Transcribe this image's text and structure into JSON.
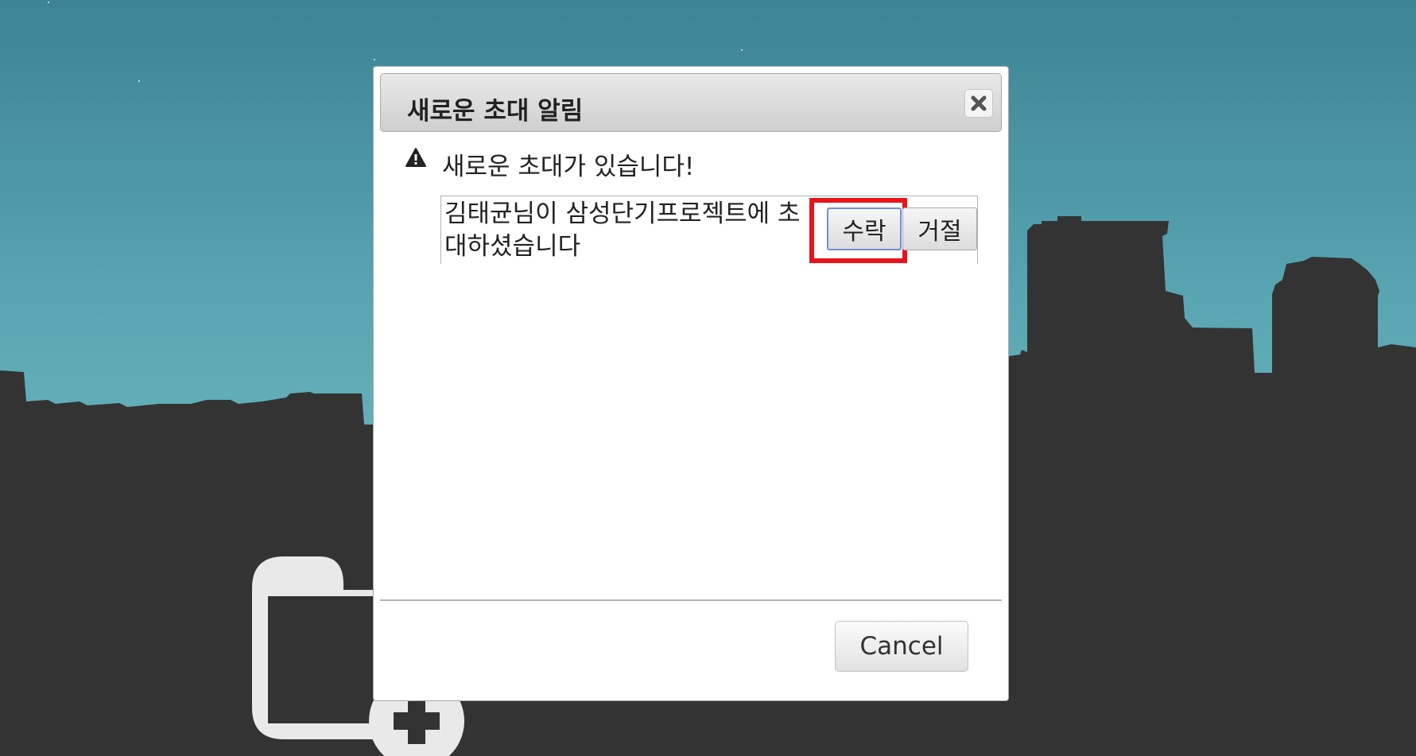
{
  "dialog": {
    "title": "새로운 초대 알림",
    "message": "새로운 초대가 있습니다!",
    "invitation": {
      "text_line1": "김태균님이 삼성단기프로젝트에 초",
      "text_line2": "대하셨습니다",
      "accept_label": "수락",
      "reject_label": "거절"
    },
    "cancel_label": "Cancel"
  },
  "icons": {
    "close": "close-icon",
    "warning": "warning-icon",
    "background": "folder-plus-icon"
  },
  "colors": {
    "highlight": "#e8141c",
    "sky": "#4c97a6",
    "silhouette": "#333333"
  }
}
